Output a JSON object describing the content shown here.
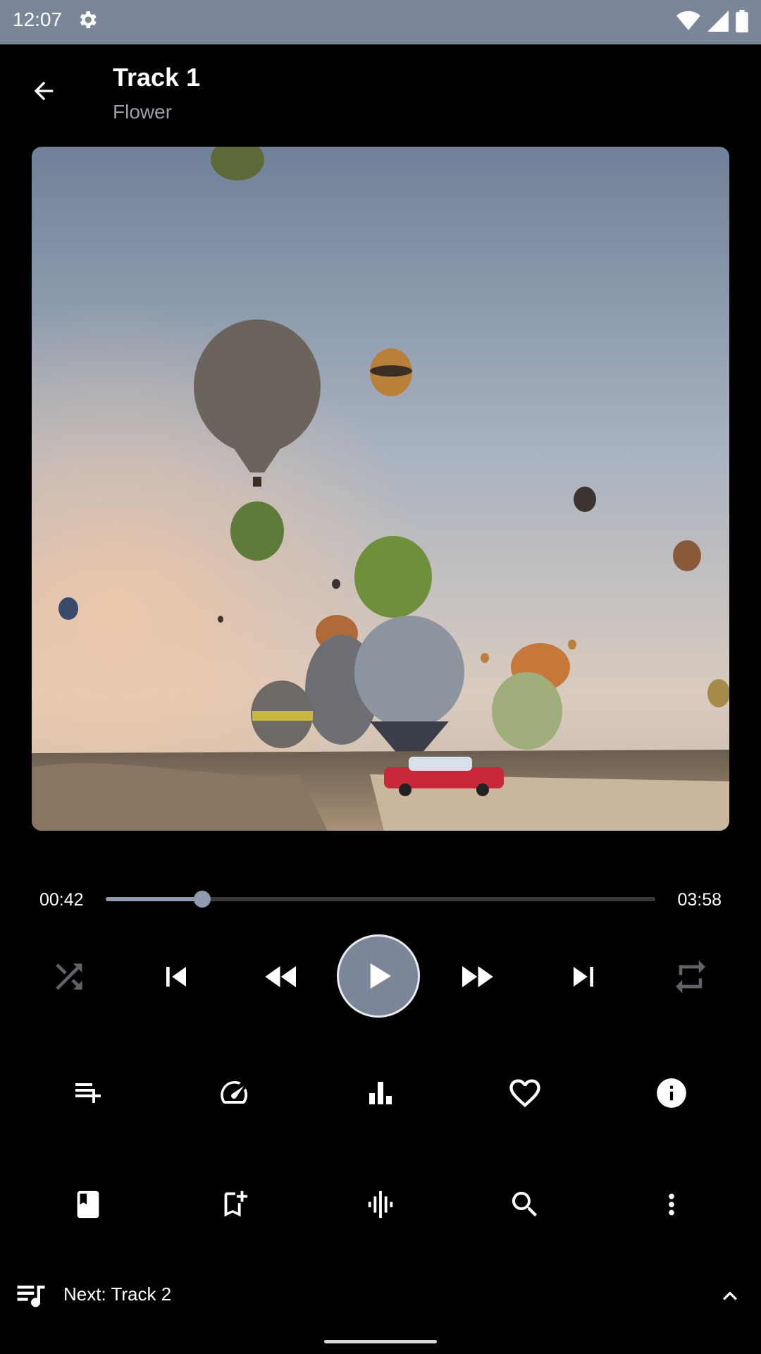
{
  "status_bar": {
    "time": "12:07",
    "icons": [
      "gear-icon",
      "wifi-icon",
      "signal-icon",
      "battery-icon"
    ]
  },
  "header": {
    "title": "Track 1",
    "subtitle": "Flower",
    "back_icon": "arrow-back-icon"
  },
  "artwork": {
    "description_icon": "album-art-image"
  },
  "player": {
    "elapsed": "00:42",
    "total": "03:58",
    "progress_fraction": 0.176,
    "is_playing": false,
    "controls": [
      "shuffle-icon",
      "skip-previous-icon",
      "rewind-icon",
      "play-icon",
      "fast-forward-icon",
      "skip-next-icon",
      "repeat-icon"
    ]
  },
  "actions_row_1": [
    "playlist-add-icon",
    "speed-icon",
    "equalizer-icon",
    "heart-icon",
    "info-icon"
  ],
  "actions_row_2": [
    "bookmark-icon",
    "bookmark-add-icon",
    "waveform-icon",
    "search-icon",
    "more-vert-icon"
  ],
  "next_bar": {
    "label": "Next: Track 2",
    "icon": "queue-music-icon",
    "expand_icon": "chevron-up-icon"
  },
  "colors": {
    "accent": "#7b8798",
    "background": "#000000",
    "status_bar": "#7b8798",
    "muted": "#9aa0a6"
  }
}
